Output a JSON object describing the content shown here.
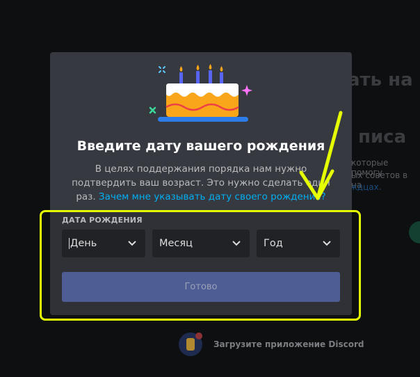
{
  "background": {
    "heading_line1": "ать на",
    "heading_line2": "писа",
    "paragraph_line1": "которые помогу",
    "paragraph_line2": "ых советов в на",
    "link_fragment": "ждцах.",
    "footer_text": "Загрузите приложение Discord"
  },
  "modal": {
    "title": "Введите дату вашего рождения",
    "description": "В целях поддержания порядка нам нужно подтвердить ваш возраст. Это нужно сделать один раз.",
    "description_link": "Зачем мне указывать дату своего рождения?",
    "form": {
      "label": "ДАТА РОЖДЕНИЯ",
      "day_placeholder": "День",
      "month_placeholder": "Месяц",
      "year_placeholder": "Год",
      "submit_label": "Готово"
    }
  },
  "colors": {
    "modal_bg": "#36393f",
    "form_bg": "#2f3136",
    "input_bg": "#202225",
    "button_bg": "#4e5d94",
    "link": "#00aff4",
    "annotation": "#e6ff00"
  }
}
